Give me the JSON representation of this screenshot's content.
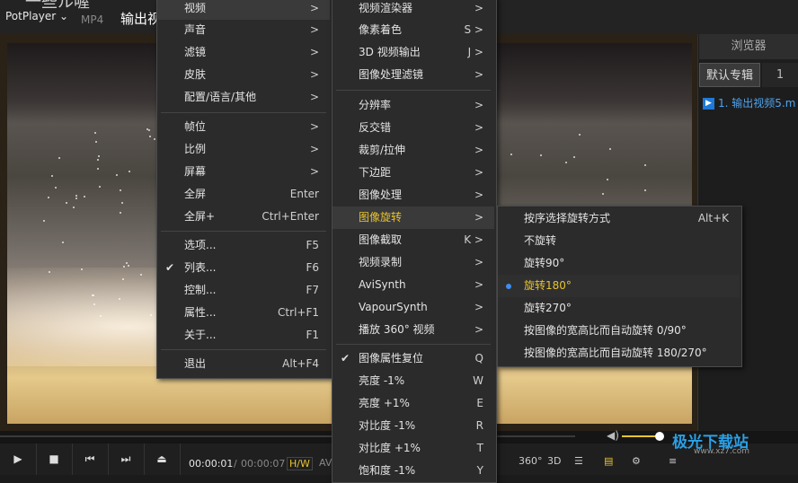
{
  "window": {
    "app_menu": "PotPlayer",
    "format": "MP4",
    "file_title": "输出视",
    "top_text": "一些ル喔"
  },
  "right_panel": {
    "browser_tab": "浏览器",
    "album_tab": "默认专辑",
    "album_count": "1",
    "playlist_item": "1. 输出视频5.m"
  },
  "controls": {
    "time_current": "00:00:01",
    "time_sep": "/",
    "time_total": "00:00:07",
    "hw_label": "H/W",
    "av_label": "AV",
    "btn_360": "360°",
    "btn_3d": "3D",
    "volume_fraction": 0.85,
    "seek_fraction": 0.0
  },
  "watermark": {
    "text": "极光下载站",
    "sub": "www.xz7.com"
  },
  "menu1": {
    "items": [
      {
        "label": "视频",
        "arrow": ">"
      },
      {
        "label": "声音",
        "arrow": ">"
      },
      {
        "label": "滤镜",
        "arrow": ">"
      },
      {
        "label": "皮肤",
        "arrow": ">"
      },
      {
        "label": "配置/语言/其他",
        "arrow": ">"
      },
      {
        "label": "帧位",
        "arrow": ">"
      },
      {
        "label": "比例",
        "arrow": ">"
      },
      {
        "label": "屏幕",
        "arrow": ">"
      },
      {
        "label": "全屏",
        "shortcut": "Enter"
      },
      {
        "label": "全屏+",
        "shortcut": "Ctrl+Enter"
      },
      {
        "label": "选项...",
        "shortcut": "F5"
      },
      {
        "label": "列表...",
        "shortcut": "F6"
      },
      {
        "label": "控制...",
        "shortcut": "F7"
      },
      {
        "label": "属性...",
        "shortcut": "Ctrl+F1"
      },
      {
        "label": "关于...",
        "shortcut": "F1"
      },
      {
        "label": "退出",
        "shortcut": "Alt+F4"
      }
    ]
  },
  "menu2": {
    "items": [
      {
        "label": "视频渲染器",
        "shortcut": ">"
      },
      {
        "label": "像素着色",
        "shortcut": "S >"
      },
      {
        "label": "3D 视频输出",
        "shortcut": "J >"
      },
      {
        "label": "图像处理滤镜",
        "shortcut": ">"
      },
      {
        "label": "分辨率",
        "shortcut": ">"
      },
      {
        "label": "反交错",
        "shortcut": ">"
      },
      {
        "label": "裁剪/拉伸",
        "shortcut": ">"
      },
      {
        "label": "下边距",
        "shortcut": ">"
      },
      {
        "label": "图像处理",
        "shortcut": ">"
      },
      {
        "label": "图像旋转",
        "shortcut": ">"
      },
      {
        "label": "图像截取",
        "shortcut": "K >"
      },
      {
        "label": "视频录制",
        "shortcut": ">"
      },
      {
        "label": "AviSynth",
        "shortcut": ">"
      },
      {
        "label": "VapourSynth",
        "shortcut": ">"
      },
      {
        "label": "播放 360° 视频",
        "shortcut": ">"
      },
      {
        "label": "图像属性复位",
        "shortcut": "Q"
      },
      {
        "label": "亮度 -1%",
        "shortcut": "W"
      },
      {
        "label": "亮度 +1%",
        "shortcut": "E"
      },
      {
        "label": "对比度 -1%",
        "shortcut": "R"
      },
      {
        "label": "对比度 +1%",
        "shortcut": "T"
      },
      {
        "label": "饱和度 -1%",
        "shortcut": "Y"
      }
    ]
  },
  "menu3": {
    "items": [
      {
        "label": "按序选择旋转方式",
        "shortcut": "Alt+K"
      },
      {
        "label": "不旋转"
      },
      {
        "label": "旋转90°"
      },
      {
        "label": "旋转180°"
      },
      {
        "label": "旋转270°"
      },
      {
        "label": "按图像的宽高比而自动旋转 0/90°"
      },
      {
        "label": "按图像的宽高比而自动旋转 180/270°"
      }
    ]
  },
  "colors": {
    "accent_yellow": "#e8c330",
    "accent_blue": "#3d8ef0"
  }
}
